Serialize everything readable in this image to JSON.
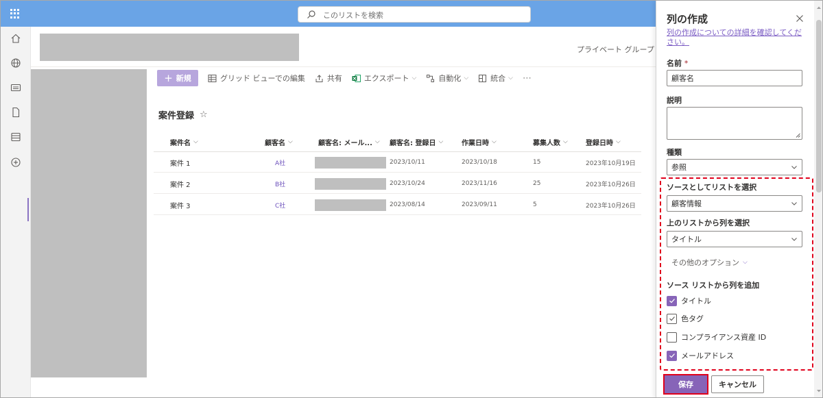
{
  "topbar": {
    "search_placeholder": "このリストを検索"
  },
  "site": {
    "privacy_label": "プライベート グループ"
  },
  "commandbar": {
    "new_label": "新規",
    "grid_edit_label": "グリッド ビューでの編集",
    "share_label": "共有",
    "export_label": "エクスポート",
    "automate_label": "自動化",
    "integrate_label": "統合",
    "more_label": "⋯"
  },
  "list": {
    "title": "案件登録",
    "columns": [
      "案件名",
      "顧客名",
      "顧客名: メール...",
      "顧客名: 登録日",
      "作業日時",
      "募集人数",
      "登録日時"
    ],
    "rows": [
      {
        "name": "案件 1",
        "customer": "A社",
        "reg_date": "2023/10/11",
        "work_date": "2023/10/18",
        "count": "15",
        "registered": "2023年10月19日"
      },
      {
        "name": "案件 2",
        "customer": "B社",
        "reg_date": "2023/10/24",
        "work_date": "2023/11/16",
        "count": "25",
        "registered": "2023年10月26日"
      },
      {
        "name": "案件 3",
        "customer": "C社",
        "reg_date": "2023/08/14",
        "work_date": "2023/09/11",
        "count": "5",
        "registered": "2023年10月26日"
      }
    ]
  },
  "panel": {
    "title": "列の作成",
    "help_link": "列の作成についての詳細を確認してください。",
    "name_label": "名前",
    "required_mark": "*",
    "name_value": "顧客名",
    "description_label": "説明",
    "type_label": "種類",
    "type_value": "参照",
    "source_list_label": "ソースとしてリストを選択",
    "source_list_value": "顧客情報",
    "column_label": "上のリストから列を選択",
    "column_value": "タイトル",
    "more_options": "その他のオプション",
    "add_columns_label": "ソース リストから列を追加",
    "checkboxes": [
      {
        "label": "タイトル",
        "state": "checked"
      },
      {
        "label": "色タグ",
        "state": "checked-disabled"
      },
      {
        "label": "コンプライアンス資産 ID",
        "state": "unchecked"
      },
      {
        "label": "メールアドレス",
        "state": "checked"
      }
    ],
    "save_label": "保存",
    "cancel_label": "キャンセル"
  },
  "colors": {
    "accent": "#8764b8",
    "topbar": "#6aa4e6",
    "highlight": "#e0001b"
  }
}
